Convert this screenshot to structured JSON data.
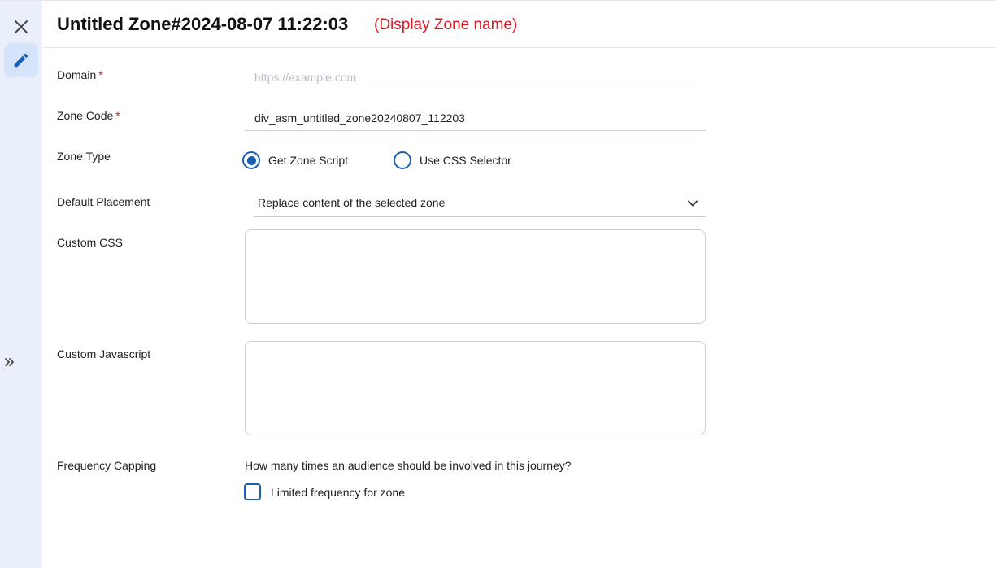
{
  "sidebar": {
    "close_icon": "close-icon",
    "edit_icon": "pencil-icon",
    "expand_icon": "double-chevron-right-icon"
  },
  "header": {
    "title": "Untitled Zone#2024-08-07 11:22:03",
    "annotation": "(Display Zone name)"
  },
  "form": {
    "domain": {
      "label": "Domain",
      "required_mark": "*",
      "value": "",
      "placeholder": "https://example.com"
    },
    "zone_code": {
      "label": "Zone Code",
      "required_mark": "*",
      "value": "div_asm_untitled_zone20240807_112203"
    },
    "zone_type": {
      "label": "Zone Type",
      "options": [
        {
          "label": "Get Zone Script",
          "selected": true
        },
        {
          "label": "Use CSS Selector",
          "selected": false
        }
      ]
    },
    "default_placement": {
      "label": "Default Placement",
      "selected": "Replace content of the selected zone"
    },
    "custom_css": {
      "label": "Custom CSS",
      "value": ""
    },
    "custom_js": {
      "label": "Custom Javascript",
      "value": ""
    },
    "frequency_capping": {
      "label": "Frequency Capping",
      "question": "How many times an audience should be involved in this journey?",
      "checkbox_label": "Limited frequency for zone",
      "checked": false
    }
  },
  "colors": {
    "accent": "#1a5fb4",
    "sidebar_bg": "#e9f0fb",
    "required": "#e0141e",
    "annotation": "#e0141e"
  }
}
